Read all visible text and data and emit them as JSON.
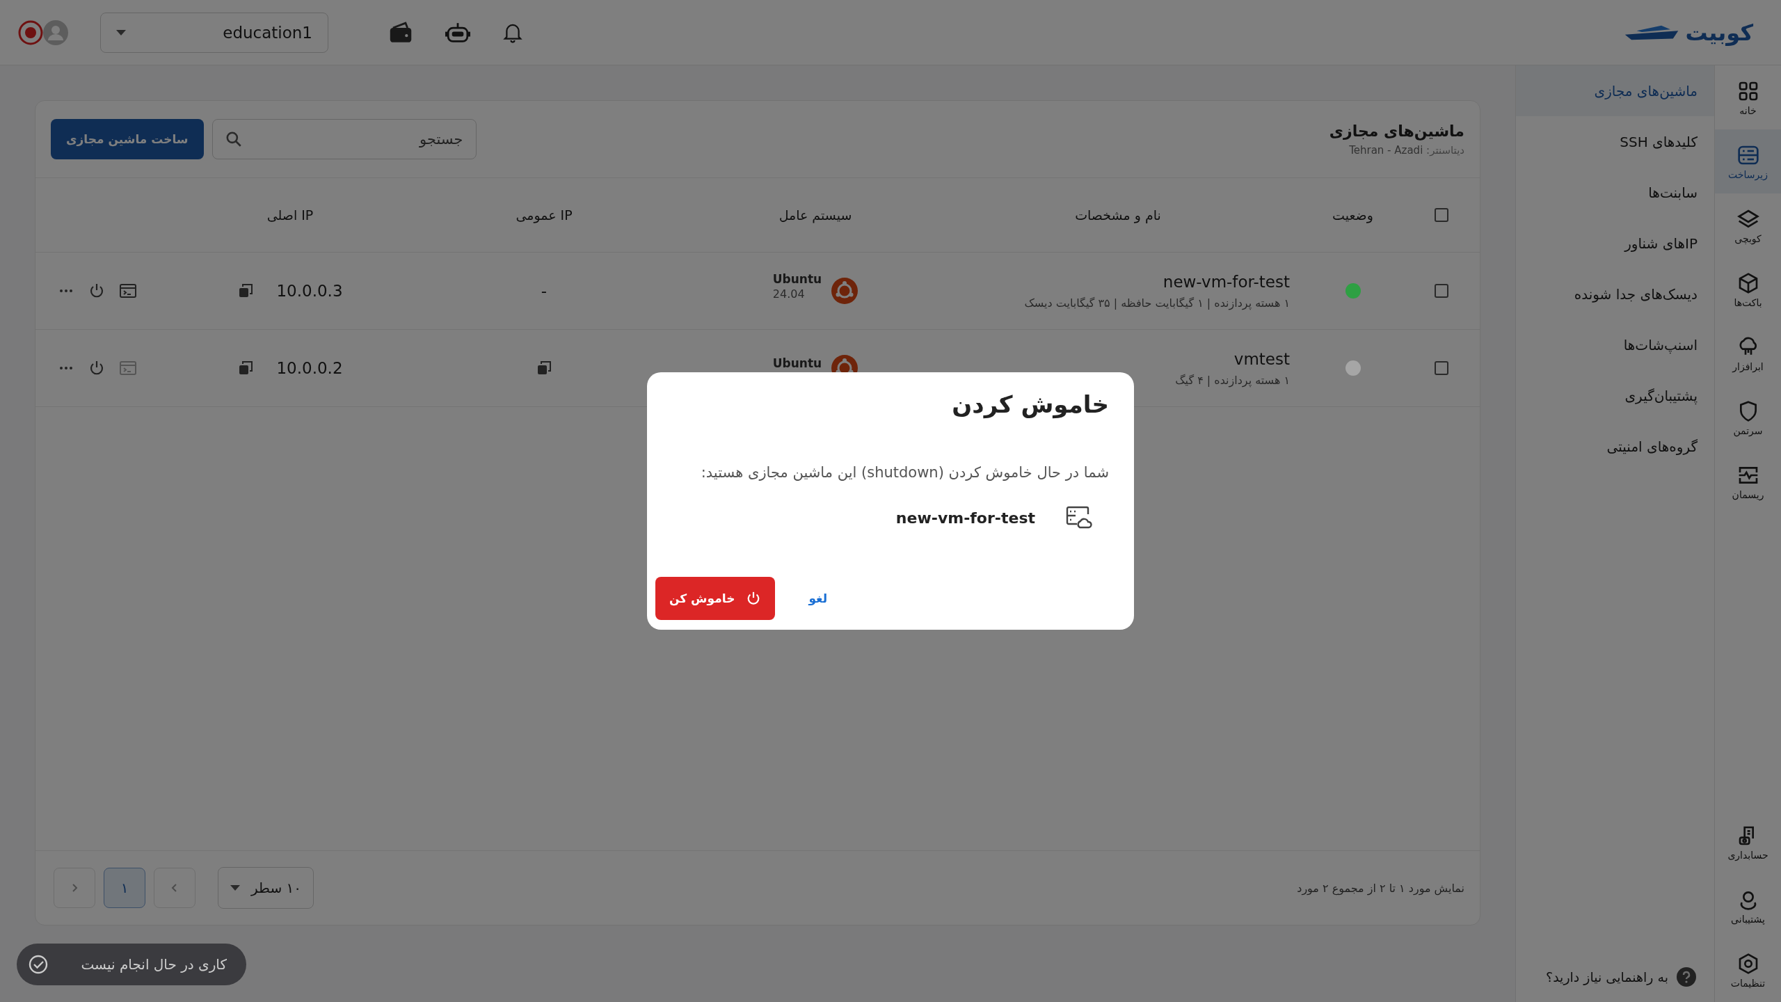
{
  "topbar": {
    "logo": "کوبیت",
    "project": "education1"
  },
  "rail": [
    {
      "label": "خانه",
      "selected": false
    },
    {
      "label": "زیرساخت",
      "selected": true
    },
    {
      "label": "کوبچی",
      "selected": false
    },
    {
      "label": "باکت‌ها",
      "selected": false
    },
    {
      "label": "ابرافزار",
      "selected": false
    },
    {
      "label": "سرتمن",
      "selected": false
    },
    {
      "label": "ریسمان",
      "selected": false
    }
  ],
  "rail_bottom": [
    {
      "label": "حسابداری"
    },
    {
      "label": "پشتیبانی"
    },
    {
      "label": "تنظیمات"
    }
  ],
  "submenu": [
    {
      "label": "ماشین‌های مجازی",
      "selected": true
    },
    {
      "label": "کلیدهای SSH",
      "selected": false
    },
    {
      "label": "سابنت‌ها",
      "selected": false
    },
    {
      "label": "IPهای شناور",
      "selected": false
    },
    {
      "label": "دیسک‌های جدا شونده",
      "selected": false
    },
    {
      "label": "اسنپ‌شات‌ها",
      "selected": false
    },
    {
      "label": "پشتیبان‌گیری",
      "selected": false
    },
    {
      "label": "گروه‌های امنیتی",
      "selected": false
    }
  ],
  "help": "به راهنمایی نیاز دارید؟",
  "page": {
    "title": "ماشین‌های مجازی",
    "datacenter_label": "دیتاسنتر:",
    "datacenter": "Tehran - Azadi",
    "search": {
      "placeholder": "جستجو"
    },
    "create_button": "ساخت ماشین مجازی"
  },
  "table": {
    "select_all": {
      "checked": false
    },
    "columns": [
      "وضعیت",
      "نام و مشخصات",
      "سیستم عامل",
      "IP عمومی",
      "IP اصلی"
    ],
    "rows": [
      {
        "checked": false,
        "color": "#2ea043",
        "name": "new-vm-for-test",
        "specs": "۱ هسته پردازنده | ۱ گیگابایت حافظه | ۳۵ گیگابایت دیسک",
        "os": "Ubuntu",
        "os_version": "24.04",
        "public_ip": "-",
        "private_ip": "10.0.0.3",
        "console_disabled": false
      },
      {
        "checked": false,
        "color": "#a6a6a6",
        "name": "vmtest",
        "specs": "۱ هسته پردازنده | ۴ گیگ",
        "os": "Ubuntu",
        "private_ip": "10.0.0.2",
        "console_disabled": true
      }
    ]
  },
  "footer": {
    "summary": "نمایش مورد ۱ تا ۲ از مجموع ۲ مورد",
    "page_size": "۱۰ سطر",
    "pages": [
      {
        "label": "۱",
        "selected": true
      }
    ]
  },
  "toast": "کاری در حال انجام نیست",
  "modal": {
    "title": "خاموش کردن",
    "message": "شما در حال خاموش کردن (shutdown) این ماشین مجازی هستید:",
    "vm_name": "new-vm-for-test",
    "confirm": "خاموش کن",
    "cancel": "لغو"
  }
}
